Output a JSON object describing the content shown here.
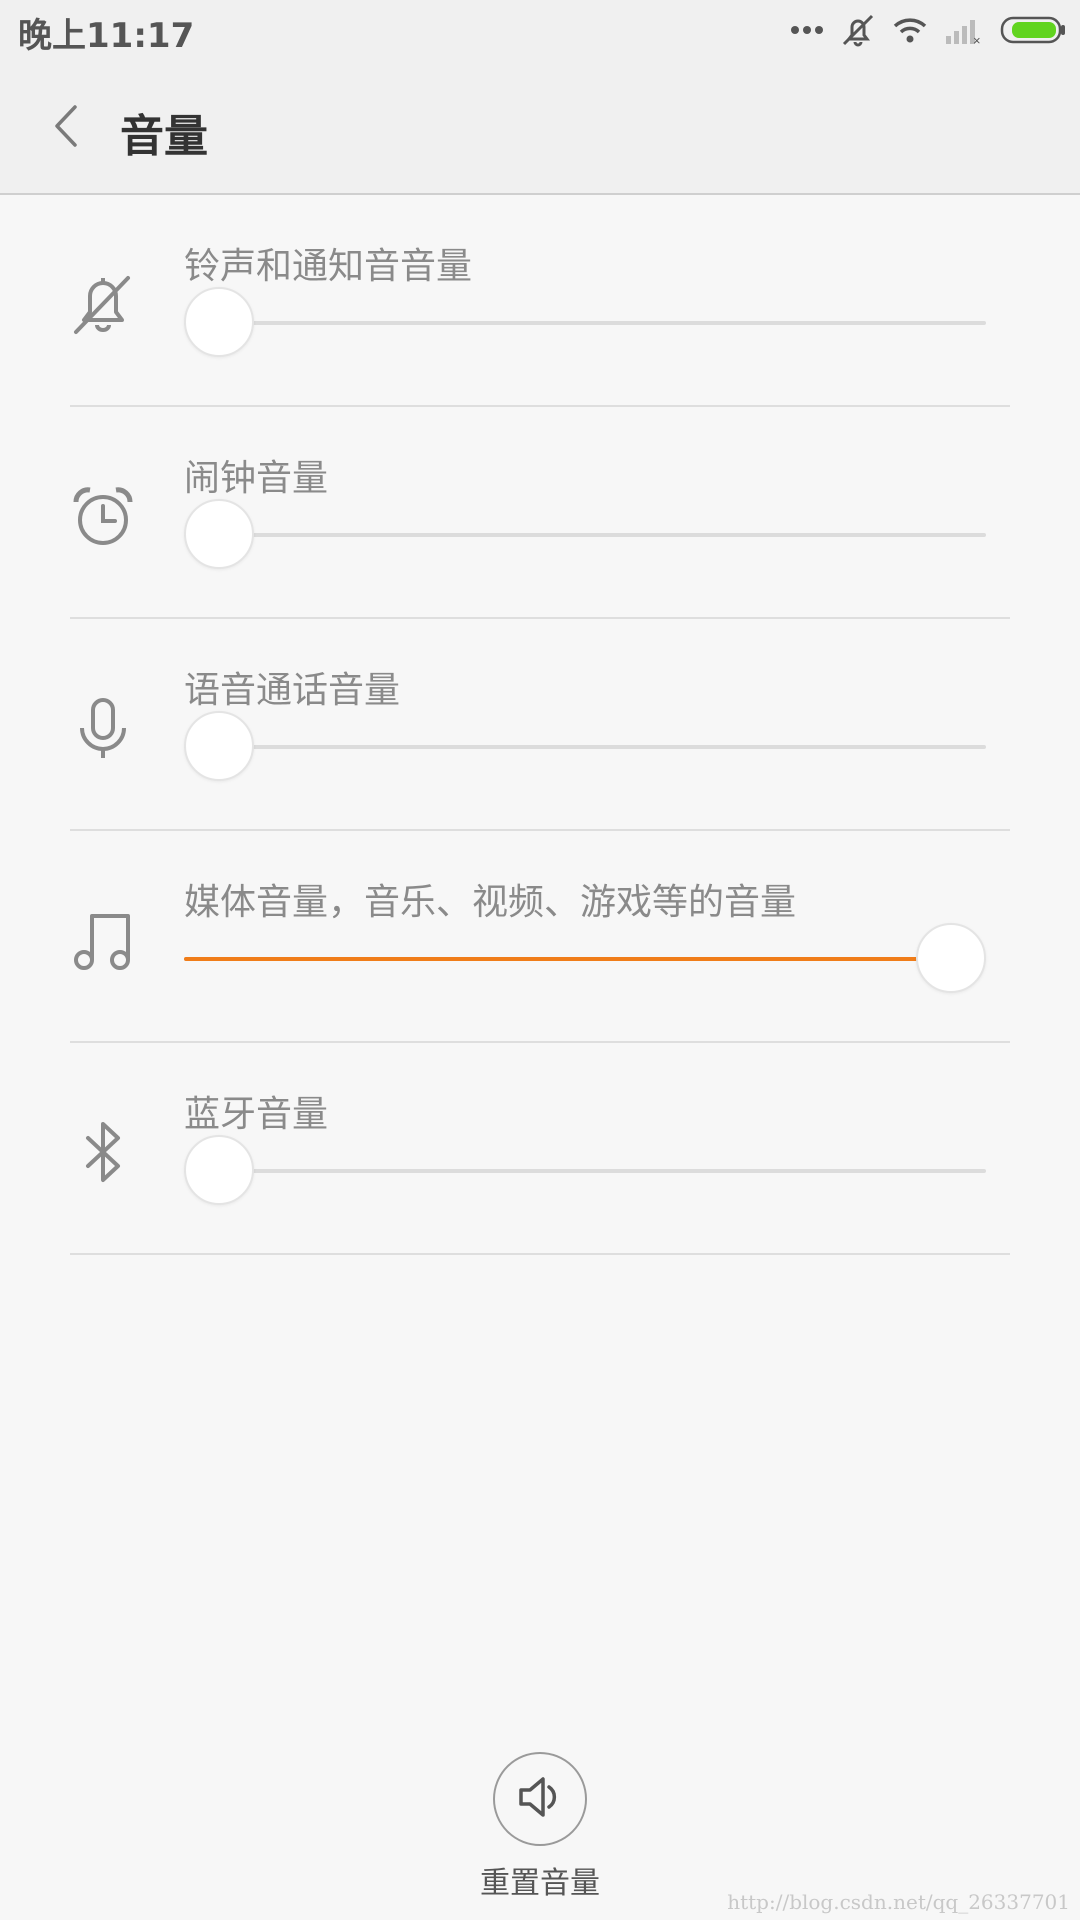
{
  "status_bar": {
    "time": "晚上11:17",
    "icons": [
      "more-dots-icon",
      "ringer-off-icon",
      "wifi-icon",
      "signal-none-icon",
      "battery-icon"
    ],
    "battery_color": "#61d41f"
  },
  "header": {
    "back_icon": "chevron-left-icon",
    "title": "音量"
  },
  "accent_color": "#f07d19",
  "volume_items": [
    {
      "label": "铃声和通知音音量",
      "icon": "bell-off-icon",
      "level": 0
    },
    {
      "label": "闹钟音量",
      "icon": "alarm-clock-icon",
      "level": 0
    },
    {
      "label": "语音通话音量",
      "icon": "microphone-icon",
      "level": 0
    },
    {
      "label": "媒体音量，音乐、视频、游戏等的音量",
      "icon": "music-note-icon",
      "level": 1
    },
    {
      "label": "蓝牙音量",
      "icon": "bluetooth-icon",
      "level": 0
    }
  ],
  "reset": {
    "icon": "speaker-icon",
    "label": "重置音量"
  },
  "watermark": "http://blog.csdn.net/qq_26337701"
}
